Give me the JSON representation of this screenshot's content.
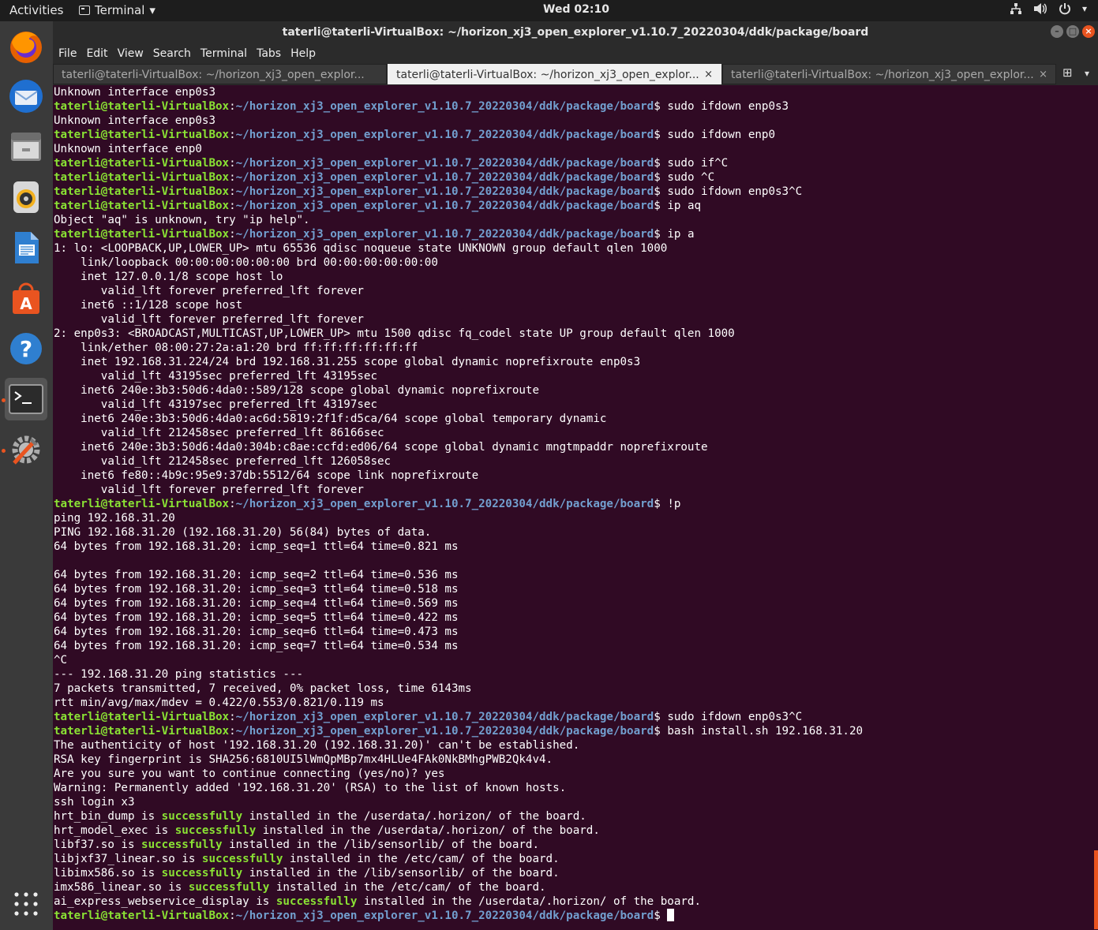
{
  "topbar": {
    "activities": "Activities",
    "app": "Terminal",
    "app_arrow": "▾",
    "clock": "Wed 02:10",
    "sys_icons": [
      "network-icon",
      "volume-icon",
      "power-icon"
    ]
  },
  "dock": {
    "items": [
      {
        "name": "firefox",
        "icon": "firefox-icon"
      },
      {
        "name": "thunderbird",
        "icon": "mail-icon"
      },
      {
        "name": "files",
        "icon": "files-icon"
      },
      {
        "name": "rhythmbox",
        "icon": "music-icon"
      },
      {
        "name": "writer",
        "icon": "document-icon"
      },
      {
        "name": "software",
        "icon": "store-icon"
      },
      {
        "name": "help",
        "icon": "help-icon"
      },
      {
        "name": "terminal",
        "icon": "terminal-icon"
      },
      {
        "name": "settings",
        "icon": "settings-icon"
      },
      {
        "name": "apps",
        "icon": "app-grid-icon"
      }
    ]
  },
  "window": {
    "title": "taterli@taterli-VirtualBox: ~/horizon_xj3_open_explorer_v1.10.7_20220304/ddk/package/board",
    "menu": [
      "File",
      "Edit",
      "View",
      "Search",
      "Terminal",
      "Tabs",
      "Help"
    ],
    "tabs": [
      {
        "label": "taterli@taterli-VirtualBox: ~/horizon_xj3_open_explor...",
        "active": false
      },
      {
        "label": "taterli@taterli-VirtualBox: ~/horizon_xj3_open_explor...",
        "active": true
      },
      {
        "label": "taterli@taterli-VirtualBox: ~/horizon_xj3_open_explor...",
        "active": false
      }
    ],
    "tab_close": "×"
  },
  "prompt": {
    "user": "taterli@taterli-VirtualBox",
    "path": "~/horizon_xj3_open_explorer_v1.10.7_20220304/ddk/package/board"
  },
  "terminal_lines": [
    {
      "t": "out",
      "text": "Unknown interface enp0s3"
    },
    {
      "t": "cmd",
      "text": "sudo ifdown enp0s3"
    },
    {
      "t": "out",
      "text": "Unknown interface enp0s3"
    },
    {
      "t": "cmd",
      "text": "sudo ifdown enp0"
    },
    {
      "t": "out",
      "text": "Unknown interface enp0"
    },
    {
      "t": "cmd",
      "text": "sudo if^C"
    },
    {
      "t": "cmd",
      "text": "sudo ^C"
    },
    {
      "t": "cmd",
      "text": "sudo ifdown enp0s3^C"
    },
    {
      "t": "cmd",
      "text": "ip aq"
    },
    {
      "t": "out",
      "text": "Object \"aq\" is unknown, try \"ip help\"."
    },
    {
      "t": "cmd",
      "text": "ip a"
    },
    {
      "t": "out",
      "text": "1: lo: <LOOPBACK,UP,LOWER_UP> mtu 65536 qdisc noqueue state UNKNOWN group default qlen 1000"
    },
    {
      "t": "out",
      "text": "    link/loopback 00:00:00:00:00:00 brd 00:00:00:00:00:00"
    },
    {
      "t": "out",
      "text": "    inet 127.0.0.1/8 scope host lo"
    },
    {
      "t": "out",
      "text": "       valid_lft forever preferred_lft forever"
    },
    {
      "t": "out",
      "text": "    inet6 ::1/128 scope host "
    },
    {
      "t": "out",
      "text": "       valid_lft forever preferred_lft forever"
    },
    {
      "t": "out",
      "text": "2: enp0s3: <BROADCAST,MULTICAST,UP,LOWER_UP> mtu 1500 qdisc fq_codel state UP group default qlen 1000"
    },
    {
      "t": "out",
      "text": "    link/ether 08:00:27:2a:a1:20 brd ff:ff:ff:ff:ff:ff"
    },
    {
      "t": "out",
      "text": "    inet 192.168.31.224/24 brd 192.168.31.255 scope global dynamic noprefixroute enp0s3"
    },
    {
      "t": "out",
      "text": "       valid_lft 43195sec preferred_lft 43195sec"
    },
    {
      "t": "out",
      "text": "    inet6 240e:3b3:50d6:4da0::589/128 scope global dynamic noprefixroute "
    },
    {
      "t": "out",
      "text": "       valid_lft 43197sec preferred_lft 43197sec"
    },
    {
      "t": "out",
      "text": "    inet6 240e:3b3:50d6:4da0:ac6d:5819:2f1f:d5ca/64 scope global temporary dynamic "
    },
    {
      "t": "out",
      "text": "       valid_lft 212458sec preferred_lft 86166sec"
    },
    {
      "t": "out",
      "text": "    inet6 240e:3b3:50d6:4da0:304b:c8ae:ccfd:ed06/64 scope global dynamic mngtmpaddr noprefixroute "
    },
    {
      "t": "out",
      "text": "       valid_lft 212458sec preferred_lft 126058sec"
    },
    {
      "t": "out",
      "text": "    inet6 fe80::4b9c:95e9:37db:5512/64 scope link noprefixroute "
    },
    {
      "t": "out",
      "text": "       valid_lft forever preferred_lft forever"
    },
    {
      "t": "cmd",
      "text": "!p"
    },
    {
      "t": "out",
      "text": "ping 192.168.31.20"
    },
    {
      "t": "out",
      "text": "PING 192.168.31.20 (192.168.31.20) 56(84) bytes of data."
    },
    {
      "t": "out",
      "text": "64 bytes from 192.168.31.20: icmp_seq=1 ttl=64 time=0.821 ms"
    },
    {
      "t": "out",
      "text": ""
    },
    {
      "t": "out",
      "text": "64 bytes from 192.168.31.20: icmp_seq=2 ttl=64 time=0.536 ms"
    },
    {
      "t": "out",
      "text": "64 bytes from 192.168.31.20: icmp_seq=3 ttl=64 time=0.518 ms"
    },
    {
      "t": "out",
      "text": "64 bytes from 192.168.31.20: icmp_seq=4 ttl=64 time=0.569 ms"
    },
    {
      "t": "out",
      "text": "64 bytes from 192.168.31.20: icmp_seq=5 ttl=64 time=0.422 ms"
    },
    {
      "t": "out",
      "text": "64 bytes from 192.168.31.20: icmp_seq=6 ttl=64 time=0.473 ms"
    },
    {
      "t": "out",
      "text": "64 bytes from 192.168.31.20: icmp_seq=7 ttl=64 time=0.534 ms"
    },
    {
      "t": "out",
      "text": "^C"
    },
    {
      "t": "out",
      "text": "--- 192.168.31.20 ping statistics ---"
    },
    {
      "t": "out",
      "text": "7 packets transmitted, 7 received, 0% packet loss, time 6143ms"
    },
    {
      "t": "out",
      "text": "rtt min/avg/max/mdev = 0.422/0.553/0.821/0.119 ms"
    },
    {
      "t": "cmd",
      "text": "sudo ifdown enp0s3^C"
    },
    {
      "t": "cmd",
      "text": "bash install.sh 192.168.31.20"
    },
    {
      "t": "out",
      "text": "The authenticity of host '192.168.31.20 (192.168.31.20)' can't be established."
    },
    {
      "t": "out",
      "text": "RSA key fingerprint is SHA256:6810UI5lWmQpMBp7mx4HLUe4FAk0NkBMhgPWB2Qk4v4."
    },
    {
      "t": "out",
      "text": "Are you sure you want to continue connecting (yes/no)? yes"
    },
    {
      "t": "out",
      "text": "Warning: Permanently added '192.168.31.20' (RSA) to the list of known hosts."
    },
    {
      "t": "out",
      "text": "ssh login x3"
    },
    {
      "t": "inst",
      "pre": "hrt_bin_dump is ",
      "ok": "successfully",
      "post": " installed in the /userdata/.horizon/ of the board."
    },
    {
      "t": "inst",
      "pre": "hrt_model_exec is ",
      "ok": "successfully",
      "post": " installed in the /userdata/.horizon/ of the board."
    },
    {
      "t": "inst",
      "pre": "libf37.so is ",
      "ok": "successfully",
      "post": " installed in the /lib/sensorlib/ of the board."
    },
    {
      "t": "inst",
      "pre": "libjxf37_linear.so is ",
      "ok": "successfully",
      "post": " installed in the /etc/cam/ of the board."
    },
    {
      "t": "inst",
      "pre": "libimx586.so is ",
      "ok": "successfully",
      "post": " installed in the /lib/sensorlib/ of the board."
    },
    {
      "t": "inst",
      "pre": "imx586_linear.so is ",
      "ok": "successfully",
      "post": " installed in the /etc/cam/ of the board."
    },
    {
      "t": "inst",
      "pre": "ai_express_webservice_display is ",
      "ok": "successfully",
      "post": " installed in the /userdata/.horizon/ of the board."
    },
    {
      "t": "cmd",
      "text": "",
      "cursor": true
    }
  ],
  "colors": {
    "terminal_bg": "#300a24",
    "prompt_user": "#8ae234",
    "prompt_path": "#729fcf",
    "accent": "#e95420"
  }
}
